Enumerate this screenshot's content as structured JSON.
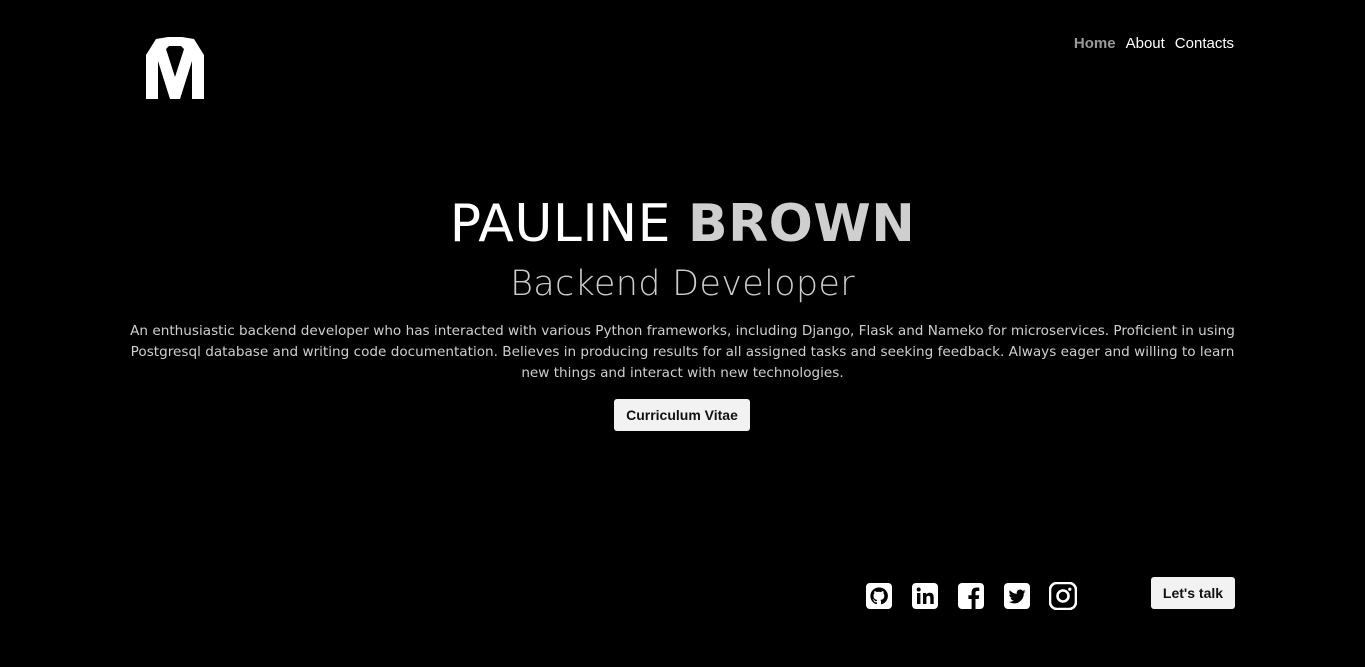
{
  "header": {
    "logo_icon": "monogram-m-logo",
    "nav": [
      {
        "label": "Home",
        "active": true
      },
      {
        "label": "About",
        "active": false
      },
      {
        "label": "Contacts",
        "active": false
      }
    ]
  },
  "hero": {
    "first_name": "PAULINE",
    "last_name": "BROWN",
    "role": "Backend Developer",
    "description": "An enthusiastic backend developer who has interacted with various Python frameworks, including Django, Flask and Nameko for microservices. Proficient in using Postgresql database and writing code documentation. Believes in producing results for all assigned tasks and seeking feedback. Always eager and willing to learn new things and interact with new technologies.",
    "cv_button": "Curriculum Vitae"
  },
  "footer": {
    "socials": [
      "github-icon",
      "linkedin-icon",
      "facebook-icon",
      "twitter-icon",
      "instagram-icon"
    ],
    "cta_button": "Let's talk"
  },
  "colors": {
    "background": "#000000",
    "text": "#ffffff",
    "accent_grey": "#cfcfcf",
    "nav_active": "#9a9a9a",
    "button_bg": "#f2f2f2"
  }
}
